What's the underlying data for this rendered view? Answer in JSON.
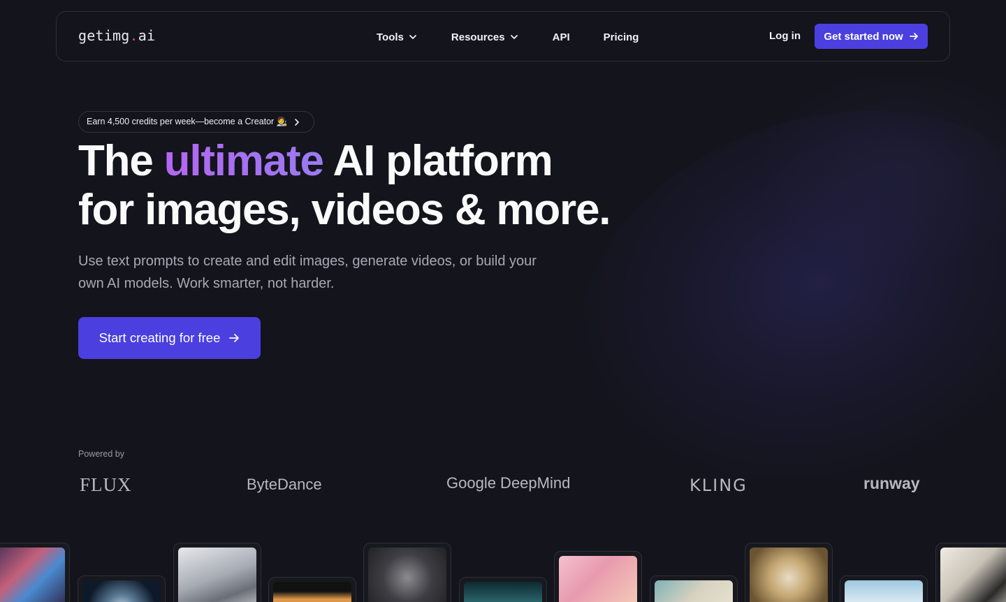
{
  "nav": {
    "logo_main": "getimg",
    "logo_dot": ".",
    "logo_tld": "ai",
    "items": [
      {
        "label": "Tools",
        "has_dropdown": true
      },
      {
        "label": "Resources",
        "has_dropdown": true
      },
      {
        "label": "API",
        "has_dropdown": false
      },
      {
        "label": "Pricing",
        "has_dropdown": false
      }
    ],
    "login": "Log in",
    "cta": "Get started now"
  },
  "hero": {
    "pill": "Earn 4,500 credits per week—become a Creator 🧑‍🎨",
    "headline_pre": "The ",
    "headline_accent": "ultimate",
    "headline_post": " AI platform",
    "headline_line2": "for images, videos & more.",
    "subtext": "Use text prompts to create and edit images, generate videos, or build your own AI models. Work smarter, not harder.",
    "cta": "Start creating for free"
  },
  "powered": {
    "label": "Powered by",
    "partners": [
      "FLUX",
      "ByteDance",
      "Google DeepMind",
      "KLING",
      "runway"
    ]
  },
  "colors": {
    "background": "#14141c",
    "accent": "#4b3fe0",
    "headline_gradient": "#b366f2"
  }
}
